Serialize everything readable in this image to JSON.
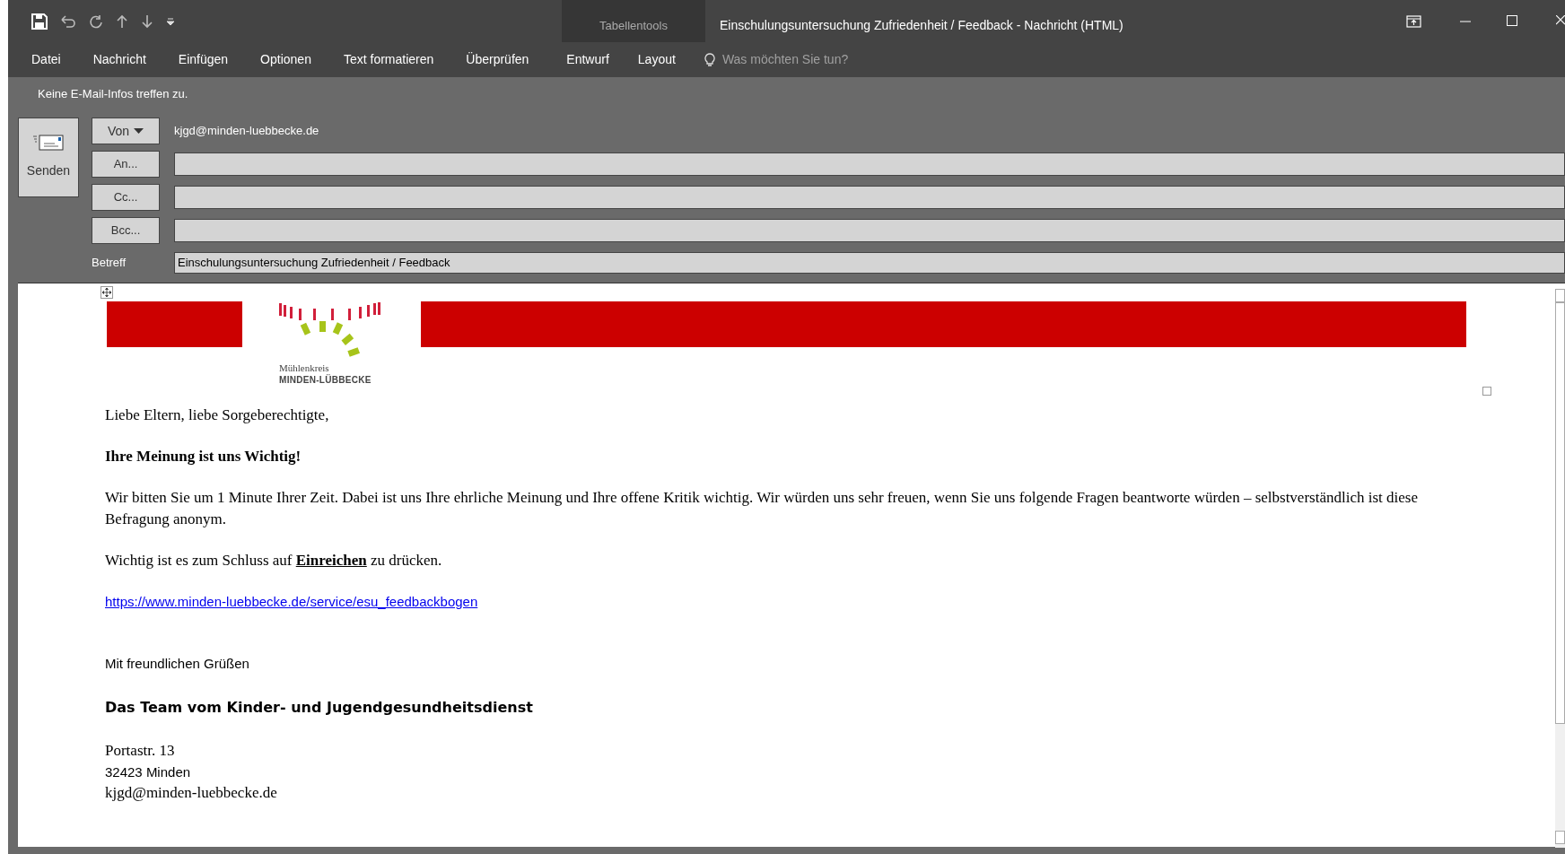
{
  "window": {
    "title": "Einschulungsuntersuchung Zufriedenheit / Feedback  - Nachricht (HTML)",
    "context_group": "Tabellentools"
  },
  "ribbon_tabs": [
    {
      "label": "Datei",
      "kind": "standard"
    },
    {
      "label": "Nachricht",
      "kind": "standard"
    },
    {
      "label": "Einfügen",
      "kind": "standard"
    },
    {
      "label": "Optionen",
      "kind": "standard"
    },
    {
      "label": "Text formatieren",
      "kind": "standard"
    },
    {
      "label": "Überprüfen",
      "kind": "standard"
    },
    {
      "label": "Entwurf",
      "kind": "contextual"
    },
    {
      "label": "Layout",
      "kind": "contextual"
    }
  ],
  "tell_me": {
    "placeholder": "Was möchten Sie tun?"
  },
  "info_bar": "Keine E-Mail-Infos treffen zu.",
  "send_button": "Senden",
  "from": {
    "button": "Von",
    "value": "kjgd@minden-luebbecke.de"
  },
  "recipients": [
    {
      "button": "An..."
    },
    {
      "button": "Cc..."
    },
    {
      "button": "Bcc..."
    }
  ],
  "subject": {
    "label": "Betreff",
    "value": "Einschulungsuntersuchung Zufriedenheit / Feedback"
  },
  "body": {
    "logo": {
      "line_1": "Mühlenkreis",
      "line_2": "MINDEN-LÜBBECKE"
    },
    "paragraphs": [
      {
        "kind": "serif",
        "text": "Liebe Eltern, liebe Sorgeberechtigte,"
      },
      {
        "kind": "heading",
        "text": "Ihre Meinung ist uns Wichtig!"
      },
      {
        "kind": "serif",
        "text": "Wir bitten Sie um 1 Minute Ihrer Zeit. Dabei ist uns Ihre ehrliche Meinung und Ihre offene Kritik wichtig. Wir würden uns sehr freuen, wenn Sie uns folgende Fragen beantworte würden – selbstverständlich ist diese Befragung anonym."
      },
      {
        "kind": "serif",
        "text": "Wichtig ist es zum Schluss auf  **Einreichen** zu drücken."
      },
      {
        "kind": "link",
        "text": "https://www.minden-luebbecke.de/service/esu_feedbackbogen"
      },
      {
        "kind": "closing",
        "text": "Mit freundlichen Grüßen"
      },
      {
        "kind": "signature",
        "text": "Das Team vom Kinder- und Jugendgesundheitsdienst"
      }
    ],
    "address": [
      {
        "kind": "serif",
        "text": "Portastr. 13"
      },
      {
        "kind": "sans",
        "text": "32423 Minden"
      },
      {
        "kind": "serif",
        "text": "kjgd@minden-luebbecke.de"
      }
    ]
  }
}
